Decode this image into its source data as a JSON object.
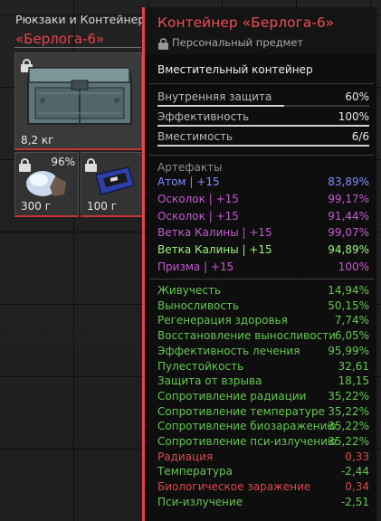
{
  "inventory": {
    "title": "Рюкзаки и Контейнеры",
    "subtitle": "«Берлога-6»",
    "main_weight": "8,2 кг",
    "slots": [
      {
        "weight": "300 г",
        "charge": "96%"
      },
      {
        "weight": "100 г"
      }
    ]
  },
  "tooltip": {
    "title": "Контейнер «Берлога-6»",
    "personal": "Персональный предмет",
    "type": "Вместительный контейнер",
    "props": [
      {
        "label": "Внутренняя защита",
        "value": "60%",
        "fill": 0.6
      },
      {
        "label": "Эффективность",
        "value": "100%",
        "fill": 1.0
      },
      {
        "label": "Вместимость",
        "value": "6/6",
        "fill": 1.0
      }
    ],
    "artifacts_label": "Артефакты",
    "artifacts": [
      {
        "name": "Атом | +15",
        "value": "83,89%",
        "color": "#7f8cff"
      },
      {
        "name": "Осколок | +15",
        "value": "99,17%",
        "color": "#c45ad1"
      },
      {
        "name": "Осколок | +15",
        "value": "91,44%",
        "color": "#c45ad1"
      },
      {
        "name": "Ветка Калины | +15",
        "value": "99,07%",
        "color": "#c45ad1"
      },
      {
        "name": "Ветка Калины | +15",
        "value": "94,89%",
        "color": "#9df57a"
      },
      {
        "name": "Призма | +15",
        "value": "100%",
        "color": "#c45ad1"
      }
    ],
    "stats": [
      {
        "label": "Живучесть",
        "value": "14,94%",
        "color": "#63c84f"
      },
      {
        "label": "Выносливость",
        "value": "50,15%",
        "color": "#63c84f"
      },
      {
        "label": "Регенерация здоровья",
        "value": "7,74%",
        "color": "#63c84f"
      },
      {
        "label": "Восстановление выносливости",
        "value": "6,05%",
        "color": "#63c84f"
      },
      {
        "label": "Эффективность лечения",
        "value": "95,99%",
        "color": "#63c84f"
      },
      {
        "label": "Пулестойкость",
        "value": "32,61",
        "color": "#63c84f"
      },
      {
        "label": "Защита от взрыва",
        "value": "18,15",
        "color": "#63c84f"
      },
      {
        "label": "Сопротивление радиации",
        "value": "35,22%",
        "color": "#63c84f"
      },
      {
        "label": "Сопротивление температуре",
        "value": "35,22%",
        "color": "#63c84f"
      },
      {
        "label": "Сопротивление биозаражению",
        "value": "35,22%",
        "color": "#63c84f"
      },
      {
        "label": "Сопротивление пси-излучению",
        "value": "35,22%",
        "color": "#63c84f"
      },
      {
        "label": "Радиация",
        "value": "0,33",
        "color": "#d9494f"
      },
      {
        "label": "Температура",
        "value": "-2,44",
        "color": "#63c84f"
      },
      {
        "label": "Биологическое заражение",
        "value": "0,34",
        "color": "#d9494f"
      },
      {
        "label": "Пси-излучение",
        "value": "-2,51",
        "color": "#63c84f"
      }
    ]
  },
  "colors": {
    "accent": "#e8424a"
  }
}
